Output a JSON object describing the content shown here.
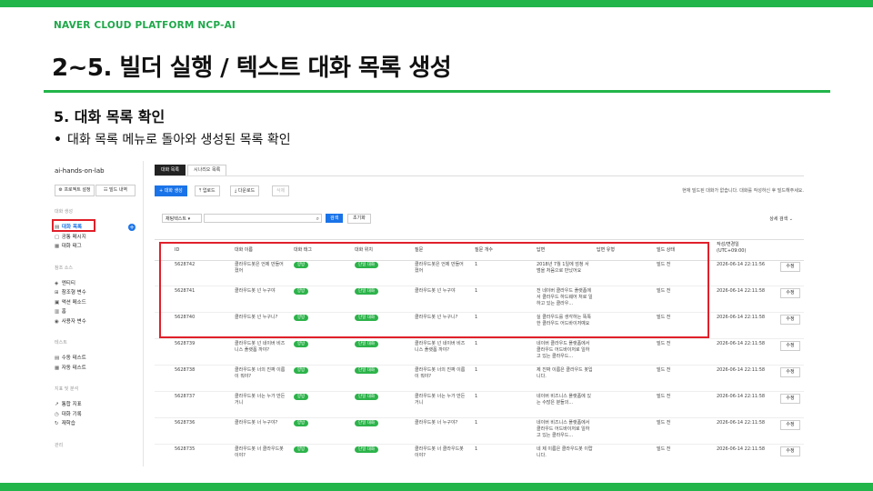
{
  "brand": "NAVER CLOUD PLATFORM NCP-AI",
  "title": "2~5. 빌더 실행 / 텍스트 대화 목록 생성",
  "section": "5. 대화 목록 확인",
  "bullet": "대화 목록 메뉴로 돌아와 생성된 목록 확인",
  "accent_color": "#22b54a",
  "highlight_color": "#e0202a",
  "screenshot": {
    "project_name": "ai-hands-on-lab",
    "side_buttons": [
      "프로젝트 설정",
      "빌드 내역"
    ],
    "sidebar_groups": [
      {
        "label": "대화 생성",
        "items": [
          {
            "label": "대화 목록",
            "icon": "list-icon",
            "active": true
          },
          {
            "label": "공통 메시지",
            "icon": "message-icon"
          },
          {
            "label": "대화 태그",
            "icon": "tag-icon"
          }
        ]
      },
      {
        "label": "참조 소스",
        "items": [
          {
            "label": "엔티티",
            "icon": "entity-icon"
          },
          {
            "label": "참조형 변수",
            "icon": "variable-icon"
          },
          {
            "label": "액션 메소드",
            "icon": "action-icon"
          },
          {
            "label": "홈",
            "icon": "home-icon"
          },
          {
            "label": "사용자 변수",
            "icon": "user-variable-icon"
          }
        ]
      },
      {
        "label": "테스트",
        "items": [
          {
            "label": "수동 테스트",
            "icon": "manual-test-icon"
          },
          {
            "label": "자동 테스트",
            "icon": "auto-test-icon"
          }
        ]
      },
      {
        "label": "지표 및 분석",
        "items": [
          {
            "label": "통합 지표",
            "icon": "chart-icon"
          },
          {
            "label": "대화 기록",
            "icon": "history-icon"
          },
          {
            "label": "재학습",
            "icon": "retrain-icon"
          }
        ]
      },
      {
        "label": "관리",
        "items": []
      }
    ],
    "tabs": [
      "대화 목록",
      "시나리오 목록"
    ],
    "toolbar": [
      "+ 대화 생성",
      "업로드",
      "다운로드",
      "삭제"
    ],
    "notice": "현재 빌드된 대화가 없습니다. 대화를 작성하신 후 빌드해주세요.",
    "filter_select": "채팅텍스트",
    "search_button": "검색",
    "reset_button": "초기화",
    "detail_search": "상세 검색",
    "columns": [
      "ID",
      "대화 이름",
      "대화 태그",
      "대화 위치",
      "질문",
      "질문 개수",
      "답변",
      "답변 유형",
      "빌드 상태",
      "작성/변경일 (UTC+09:00)"
    ],
    "rows": [
      {
        "id": "5628742",
        "name": "클라우드봇은 언제 만들어 졌어",
        "tag": "양방",
        "loc": "단일 대화",
        "q": "클라우드봇은 언제 만들어졌어",
        "cnt": "1",
        "ans": "2018년 7월 1일에 엄청 서 범을 처음으로 만났어요",
        "type": "",
        "build": "빌드 전",
        "date": "2026-06-14 22:11:56",
        "edit": "수정"
      },
      {
        "id": "5628741",
        "name": "클라우드봇 넌 누구야",
        "tag": "양방",
        "loc": "단일 대화",
        "q": "클라우드봇 넌 누구야",
        "cnt": "1",
        "ans": "전 네이버 클라우드 플랫폼에서 클라우드 하드웨어 처로 일하고 있는 클라우...",
        "type": "",
        "build": "빌드 전",
        "date": "2026-06-14 22:11:58",
        "edit": "수정"
      },
      {
        "id": "5628740",
        "name": "클라우드봇 넌 누구니?",
        "tag": "양방",
        "loc": "단일 대화",
        "q": "클라우드봇 넌 누구니?",
        "cnt": "1",
        "ans": "실 클라우드를 생각하는 똑똑한 클라우드 어드바이저예요",
        "type": "",
        "build": "빌드 전",
        "date": "2026-06-14 22:11:58",
        "edit": "수정"
      },
      {
        "id": "5628739",
        "name": "클라우드봇 넌 네이버 비즈니스 플랫폼 까야?",
        "tag": "양방",
        "loc": "단일 대화",
        "q": "클라우드봇 넌 네이버 비즈니스 플랫폼 까야?",
        "cnt": "1",
        "ans": "네이버 클라우드 플랫폼에서 클라우드 어드바이저로 일하고 있는 클라우드...",
        "type": "",
        "build": "빌드 전",
        "date": "2026-06-14 22:11:58",
        "edit": "수정"
      },
      {
        "id": "5628738",
        "name": "클라우드봇 너의 진짜 이름이 뭐야?",
        "tag": "양방",
        "loc": "단일 대화",
        "q": "클라우드봇 너의 진짜 이름이 뭐야?",
        "cnt": "1",
        "ans": "제 진짜 이름은 클라우드 봇입니다.",
        "type": "",
        "build": "빌드 전",
        "date": "2026-06-14 22:11:58",
        "edit": "수정"
      },
      {
        "id": "5628737",
        "name": "클라우드봇 너는 누가 만든 거니",
        "tag": "양방",
        "loc": "단일 대화",
        "q": "클라우드봇 너는 누가 만든 거니",
        "cnt": "1",
        "ans": "네이버 비즈니스 플랫폼에 있는 수많은 분들의...",
        "type": "",
        "build": "빌드 전",
        "date": "2026-06-14 22:11:58",
        "edit": "수정"
      },
      {
        "id": "5628736",
        "name": "클라우드봇 너 누구야?",
        "tag": "양방",
        "loc": "단일 대화",
        "q": "클라우드봇 너 누구야?",
        "cnt": "1",
        "ans": "네이버 비즈니스 플랫폼에서 클라우드 어드바이저로 일하고 있는 클라우드...",
        "type": "",
        "build": "빌드 전",
        "date": "2026-06-14 22:11:58",
        "edit": "수정"
      },
      {
        "id": "5628735",
        "name": "클라우드봇 너 클라우드봇이야?",
        "tag": "양방",
        "loc": "단일 대화",
        "q": "클라우드봇 너 클라우드봇이야?",
        "cnt": "1",
        "ans": "네 제 이름은 클라우드봇 이랍니다.",
        "type": "",
        "build": "빌드 전",
        "date": "2026-06-14 22:11:58",
        "edit": "수정"
      },
      {
        "id": "5628734",
        "name": "클라우드봇 너 별난생이야?",
        "tag": "양방",
        "loc": "단일 대화",
        "q": "클라우드봇 너 별난생이야?",
        "cnt": "1",
        "ans": "제가 처음 세상에 공개된 건 2018년 7월 1일이...",
        "type": "",
        "build": "빌드 전",
        "date": "2026-06-14 22:11:58",
        "edit": "수정"
      }
    ]
  }
}
